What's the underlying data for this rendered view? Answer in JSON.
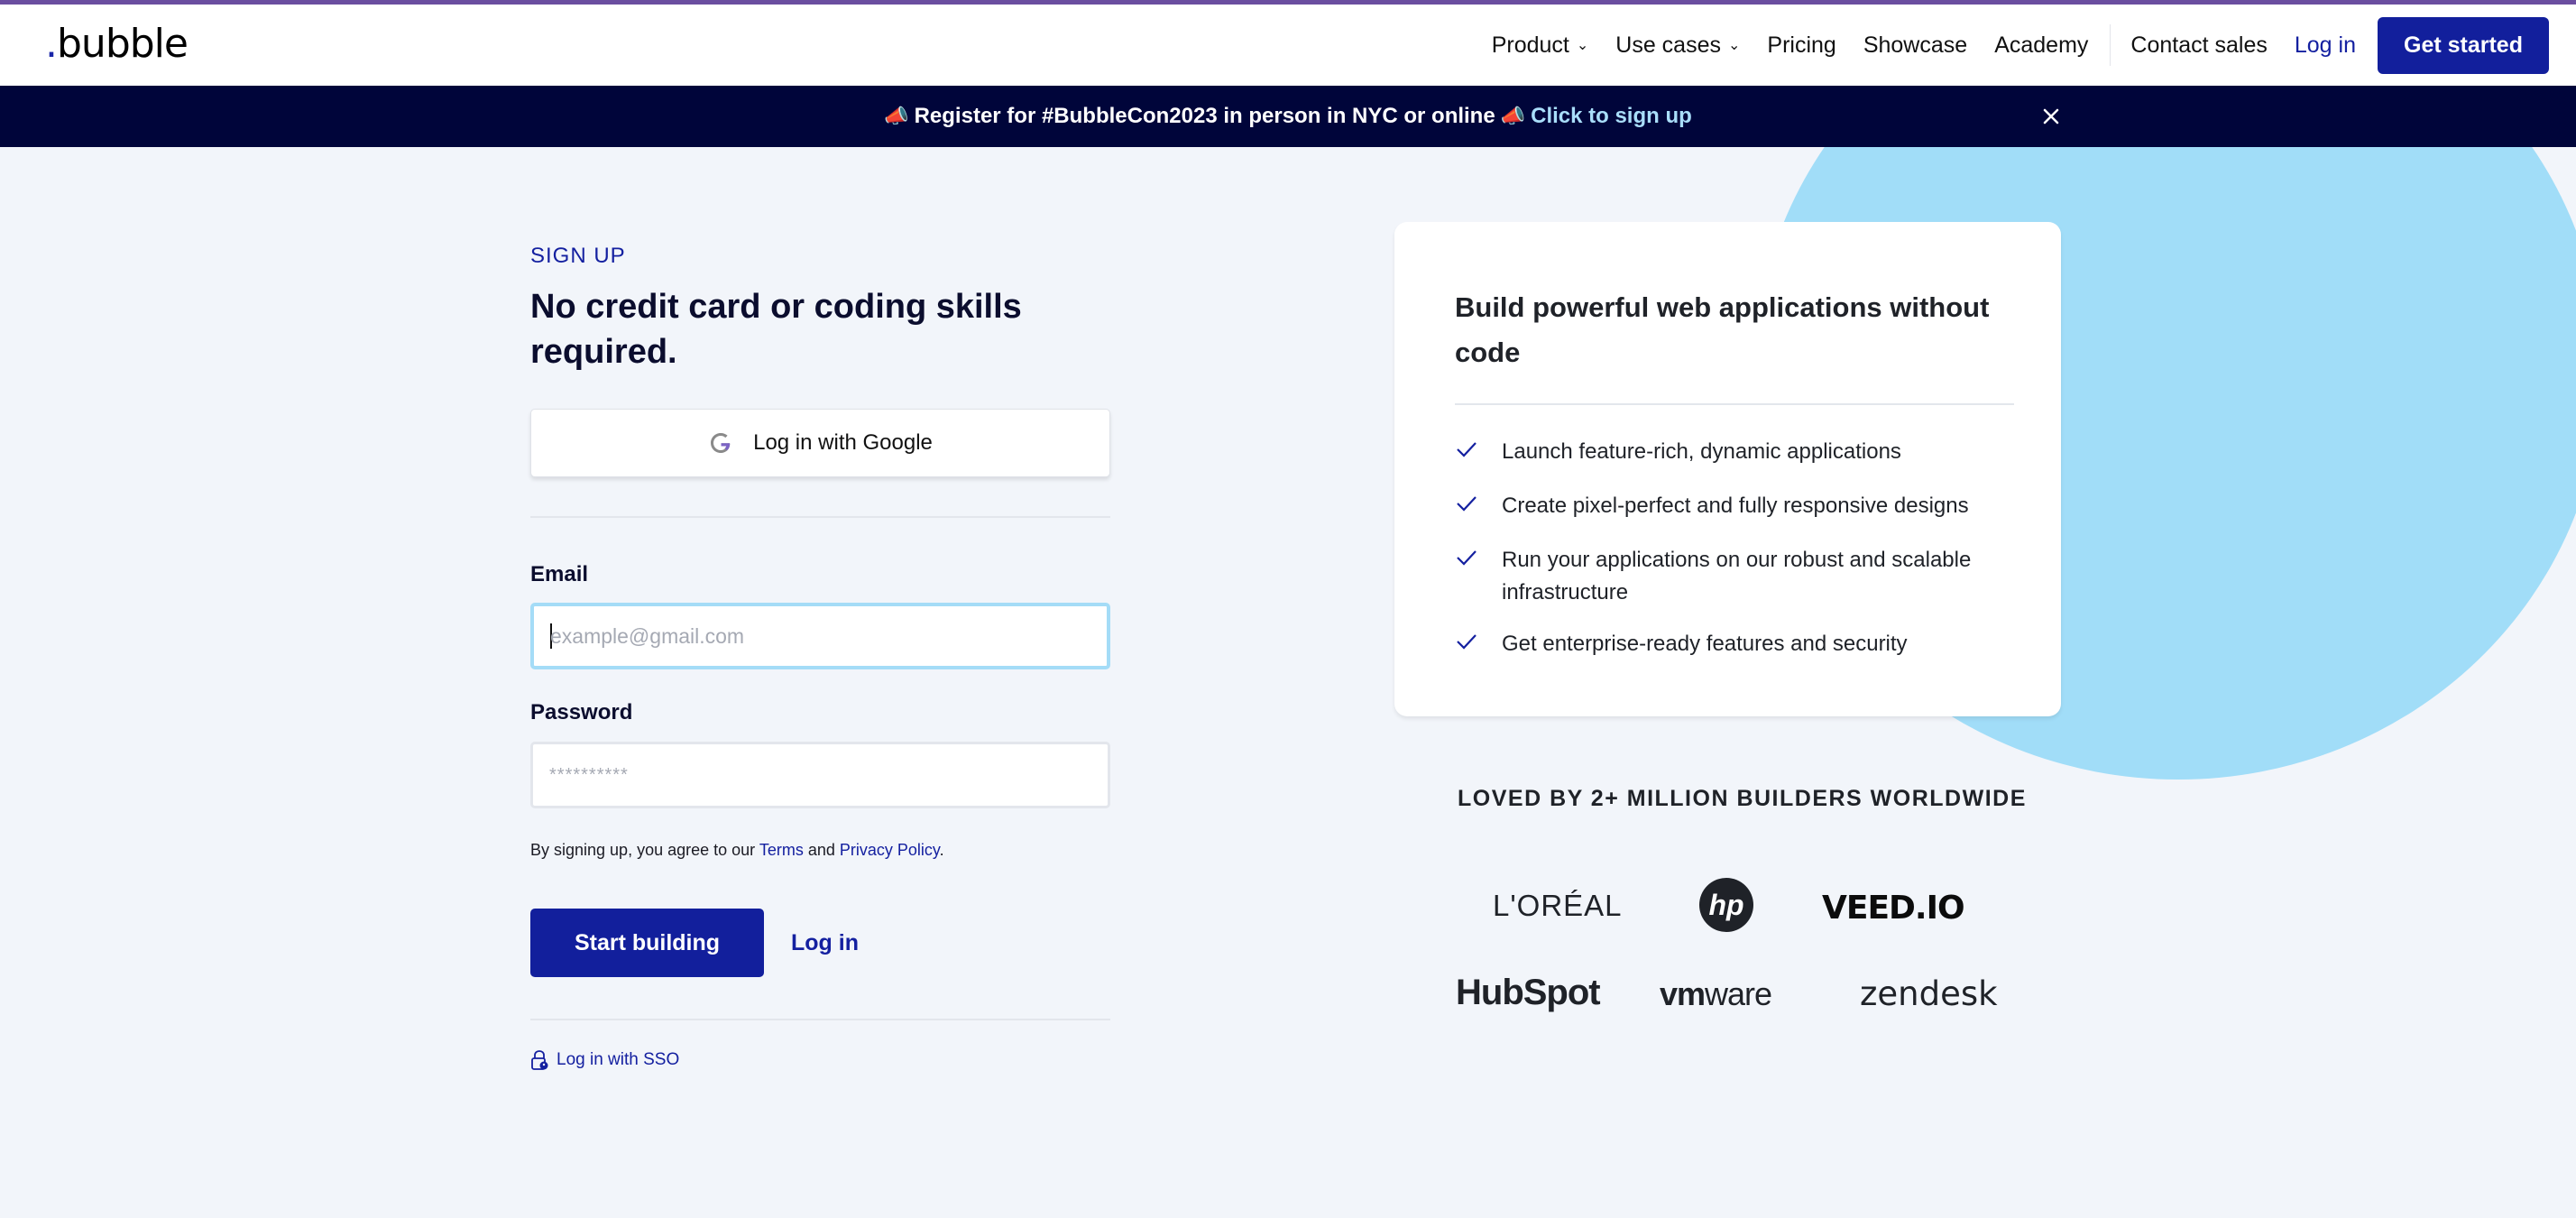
{
  "header": {
    "logo_dot": ".",
    "logo_text": "bubble",
    "nav": [
      {
        "label": "Product",
        "dropdown": true
      },
      {
        "label": "Use cases",
        "dropdown": true
      },
      {
        "label": "Pricing",
        "dropdown": false
      },
      {
        "label": "Showcase",
        "dropdown": false
      },
      {
        "label": "Academy",
        "dropdown": false
      }
    ],
    "contact_sales": "Contact sales",
    "login": "Log in",
    "get_started": "Get started"
  },
  "banner": {
    "icon": "megaphone-icon",
    "text": "Register for #BubbleCon2023 in person in NYC or online",
    "link": "Click to sign up",
    "close_icon": "close-icon"
  },
  "form": {
    "eyebrow": "SIGN UP",
    "headline": "No credit card or coding skills required.",
    "google_button": "Log in with Google",
    "email_label": "Email",
    "email_placeholder": "example@gmail.com",
    "email_value": "",
    "password_label": "Password",
    "password_placeholder": "**********",
    "password_value": "",
    "terms_prefix": "By signing up, you agree to our ",
    "terms_link": "Terms",
    "terms_and": " and ",
    "privacy_link": "Privacy Policy",
    "terms_suffix": ".",
    "start_button": "Start building",
    "login_link": "Log in",
    "sso_link": "Log in with SSO"
  },
  "card": {
    "title": "Build powerful web applications without code",
    "features": [
      "Launch feature-rich, dynamic applications",
      "Create pixel-perfect and fully responsive designs",
      "Run your applications on our robust and scalable infrastructure",
      "Get enterprise-ready features and security"
    ]
  },
  "social_proof": {
    "heading": "LOVED BY 2+ MILLION BUILDERS WORLDWIDE",
    "logos": [
      "L'ORÉAL",
      "hp",
      "VEED.IO",
      "HubSpot",
      "vm",
      "ware",
      "zendesk"
    ]
  },
  "colors": {
    "brand_primary": "#121f9c",
    "banner_bg": "#00053a",
    "banner_link": "#a9defa",
    "accent_blob": "#a1ddf8",
    "page_bg": "#f2f5fa",
    "top_accent": "#6b4ea0"
  }
}
